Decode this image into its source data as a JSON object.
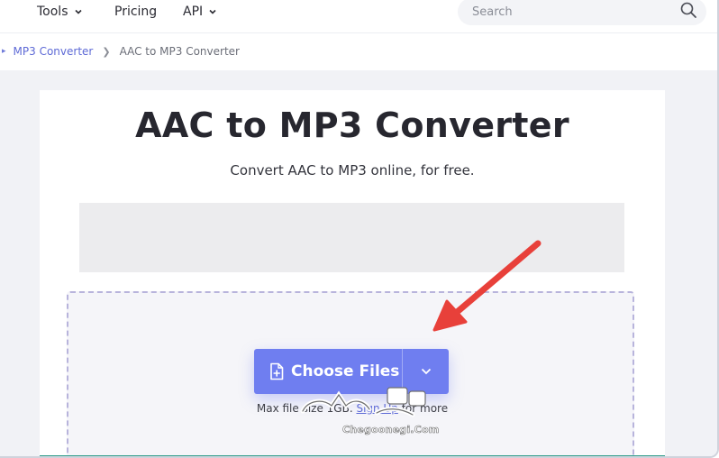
{
  "nav": {
    "tools_label": "Tools",
    "pricing_label": "Pricing",
    "api_label": "API",
    "search_placeholder": "Search"
  },
  "breadcrumb": {
    "items": [
      "MP3 Converter",
      "AAC to MP3 Converter"
    ]
  },
  "hero": {
    "title": "AAC to MP3 Converter",
    "subtitle": "Convert AAC to MP3 online, for free."
  },
  "upload": {
    "button_label": "Choose Files",
    "max_size_prefix": "Max file size 1GB.",
    "signup_label": "Sign Up",
    "max_size_suffix": "for more"
  },
  "watermark": {
    "text": "Chegoonegi.Com"
  },
  "colors": {
    "accent": "#6f7ef0",
    "link": "#5e6ad6",
    "annotation_arrow": "#e8403a",
    "dropzone_border": "#b8b4dc",
    "footer_line": "#2e9b89"
  },
  "icons": [
    "chevron-down-icon",
    "search-icon",
    "chevron-right-icon",
    "file-add-icon",
    "annotation-arrow",
    "watermark-logo"
  ]
}
